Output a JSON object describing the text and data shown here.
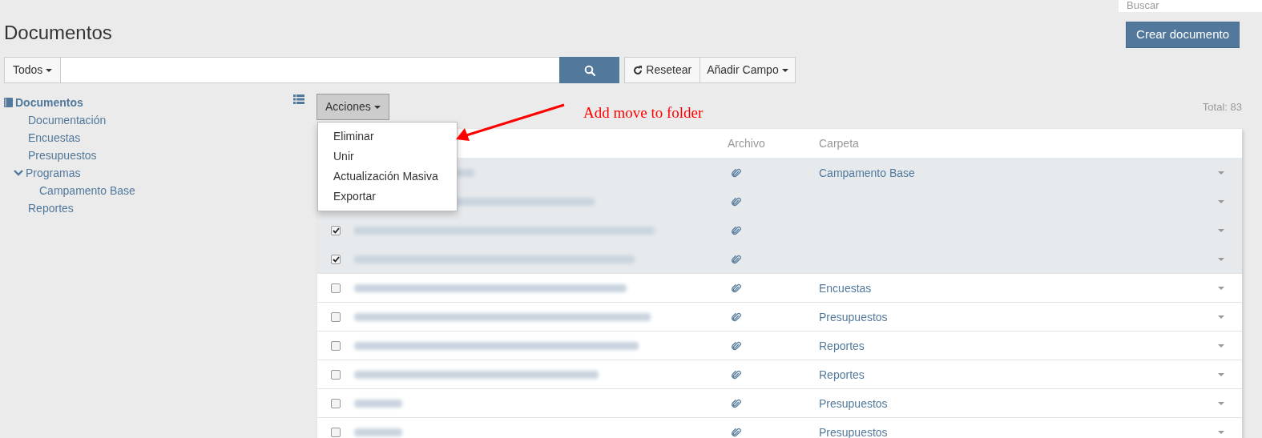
{
  "header_search": {
    "placeholder": "Buscar"
  },
  "page_title": "Documentos",
  "create_button": "Crear documento",
  "search_bar": {
    "scope": "Todos",
    "reset": "Resetear",
    "add_field": "Añadir Campo"
  },
  "tree": [
    {
      "label": "Documentos",
      "selected": true,
      "expanded": true,
      "children": [
        {
          "label": "Documentación",
          "selected": false
        },
        {
          "label": "Encuestas",
          "selected": false
        },
        {
          "label": "Presupuestos",
          "selected": false
        },
        {
          "label": "Programas",
          "selected": false,
          "expanded": true,
          "children": [
            {
              "label": "Campamento Base",
              "selected": false
            }
          ]
        },
        {
          "label": "Reportes",
          "selected": false
        }
      ]
    }
  ],
  "actions_button": "Acciones",
  "actions_menu": [
    "Eliminar",
    "Unir",
    "Actualización Masiva",
    "Exportar"
  ],
  "annotation": "Add move to folder",
  "total": "Total: 83",
  "table": {
    "columns": [
      "Archivo",
      "Carpeta"
    ],
    "rows": [
      {
        "selected": true,
        "folder": "Campamento Base"
      },
      {
        "selected": true
      },
      {
        "selected": true
      },
      {
        "selected": true
      },
      {
        "selected": false,
        "folder": "Encuestas"
      },
      {
        "selected": false,
        "folder": "Presupuestos"
      },
      {
        "selected": false,
        "folder": "Reportes"
      },
      {
        "selected": false,
        "folder": "Reportes"
      },
      {
        "selected": false,
        "folder": "Presupuestos"
      },
      {
        "selected": false,
        "folder": "Presupuestos"
      }
    ]
  }
}
